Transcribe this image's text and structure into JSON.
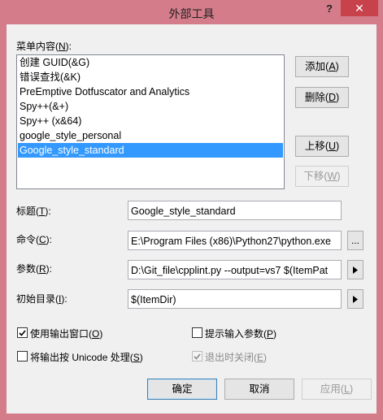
{
  "window": {
    "title": "外部工具",
    "help_glyph": "?",
    "close_glyph": "✕"
  },
  "menu_contents": {
    "label_text": "菜单内容(",
    "label_key": "N",
    "label_end": "):",
    "items": [
      "创建 GUID(&G)",
      "错误查找(&K)",
      "PreEmptive Dotfuscator and Analytics",
      "Spy++(&+)",
      "Spy++ (x&64)",
      "google_style_personal",
      "Google_style_standard"
    ],
    "selected_index": 6
  },
  "buttons": {
    "add": {
      "text": "添加(",
      "key": "A",
      "end": ")"
    },
    "delete": {
      "text": "删除(",
      "key": "D",
      "end": ")"
    },
    "move_up": {
      "text": "上移(",
      "key": "U",
      "end": ")"
    },
    "move_down": {
      "text": "下移(",
      "key": "W",
      "end": ")"
    },
    "ok": "确定",
    "cancel": "取消",
    "apply": {
      "text": "应用(",
      "key": "L",
      "end": ")"
    }
  },
  "fields": {
    "title": {
      "label_text": "标题(",
      "label_key": "T",
      "label_end": "):",
      "value": "Google_style_standard"
    },
    "command": {
      "label_text": "命令(",
      "label_key": "C",
      "label_end": "):",
      "value": "E:\\Program Files (x86)\\Python27\\python.exe",
      "browse": "..."
    },
    "arguments": {
      "label_text": "参数(",
      "label_key": "R",
      "label_end": "):",
      "value": "D:\\Git_file\\cpplint.py --output=vs7 $(ItemPat"
    },
    "initial_dir": {
      "label_text": "初始目录(",
      "label_key": "I",
      "label_end": "):",
      "value": "$(ItemDir)"
    }
  },
  "checkboxes": {
    "use_output_window": {
      "text": "使用输出窗口(",
      "key": "O",
      "end": ")",
      "checked": true
    },
    "prompt_arguments": {
      "text": "提示输入参数(",
      "key": "P",
      "end": ")",
      "checked": false
    },
    "unicode_output": {
      "text": "将输出按 Unicode 处理(",
      "key": "S",
      "end": ")",
      "checked": false
    },
    "close_on_exit": {
      "text": "退出时关闭(",
      "key": "E",
      "end": ")",
      "checked": true,
      "disabled": true
    }
  }
}
